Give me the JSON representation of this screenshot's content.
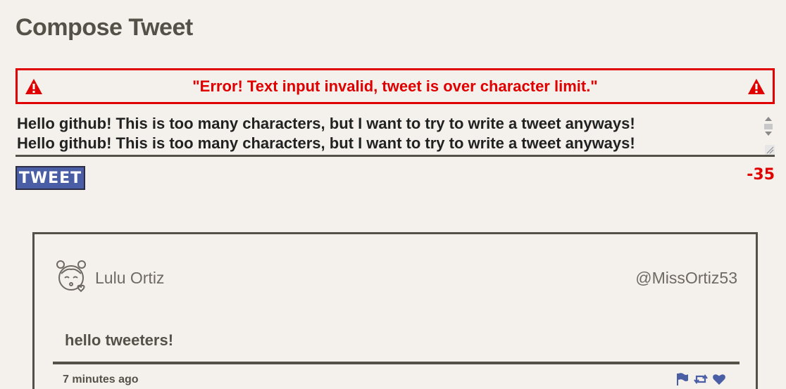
{
  "page": {
    "title": "Compose Tweet"
  },
  "error": {
    "message": "\"Error! Text input invalid, tweet is over character limit.\"",
    "color": "#e00000"
  },
  "composer": {
    "text": "Hello github! This is too many characters, but I want to try to write a tweet anyways!\nHello github! This is too many characters, but I want to try to write a tweet anyways!",
    "button_label": "TWEET",
    "counter": "-35",
    "button_color": "#4a5ea6"
  },
  "tweet": {
    "name": "Lulu Ortiz",
    "handle": "@MissOrtiz53",
    "content": "hello tweeters!",
    "timestamp": "7 minutes ago",
    "avatar_icon": "avatar-girl-kiss",
    "actions": [
      "flag-icon",
      "retweet-icon",
      "heart-icon"
    ],
    "icon_color": "#4a5ea6"
  },
  "colors": {
    "background": "#f4f1ec",
    "text": "#545149"
  }
}
